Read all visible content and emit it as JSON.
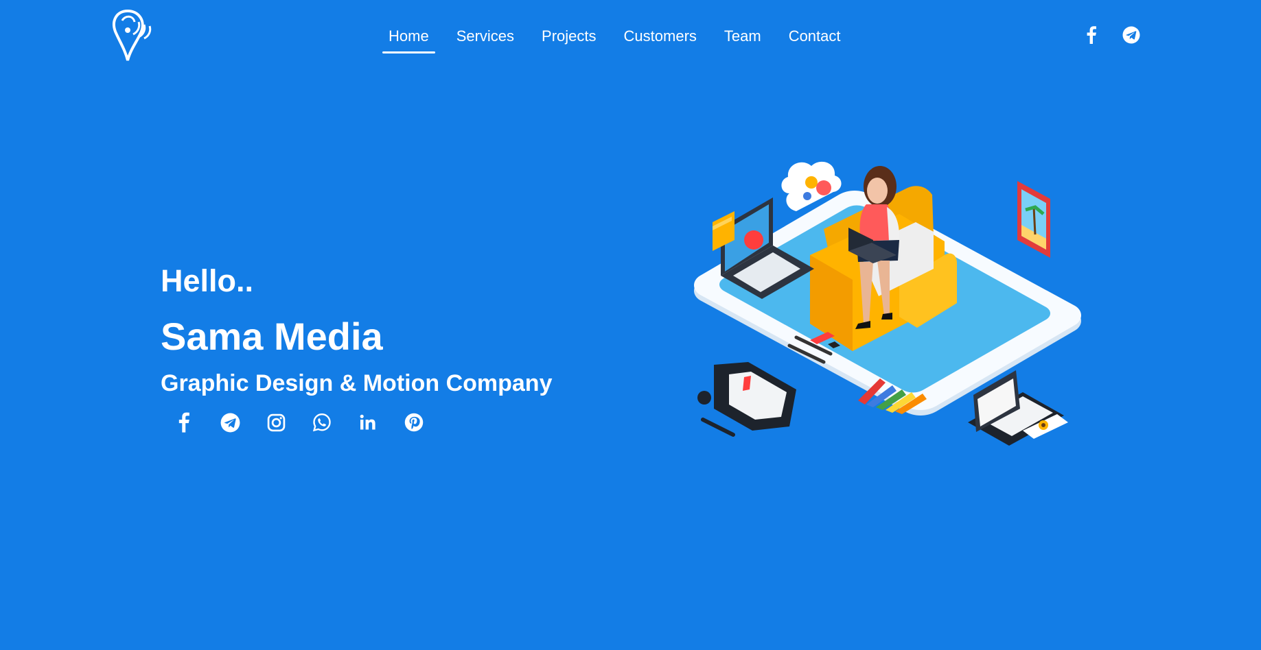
{
  "nav": {
    "items": [
      {
        "label": "Home",
        "active": true
      },
      {
        "label": "Services",
        "active": false
      },
      {
        "label": "Projects",
        "active": false
      },
      {
        "label": "Customers",
        "active": false
      },
      {
        "label": "Team",
        "active": false
      },
      {
        "label": "Contact",
        "active": false
      }
    ]
  },
  "header_social": [
    "facebook-icon",
    "telegram-icon"
  ],
  "hero": {
    "greeting": "Hello..",
    "company_name": "Sama Media",
    "tagline": "Graphic Design & Motion Company",
    "social_icons": [
      "facebook-icon",
      "telegram-icon",
      "instagram-icon",
      "whatsapp-icon",
      "linkedin-icon",
      "pinterest-icon"
    ]
  },
  "colors": {
    "background": "#137de6",
    "text": "#ffffff",
    "sofa": "#ffb300",
    "shirt": "#ff5a5a"
  }
}
